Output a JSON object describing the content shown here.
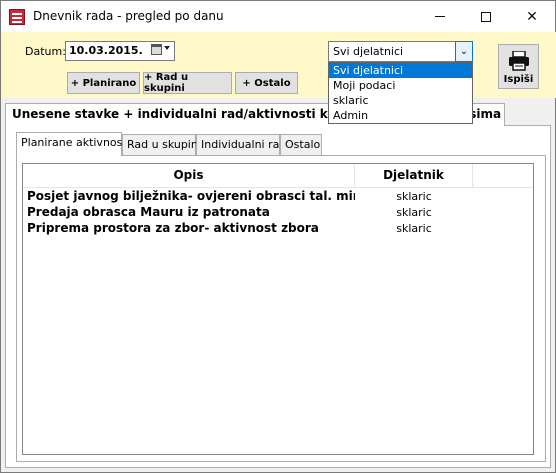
{
  "window": {
    "title": "Dnevnik rada - pregled po danu"
  },
  "filters": {
    "date_label": "Datum:",
    "date_value": "10.03.2015.",
    "worker_selected": "Svi djelatnici",
    "worker_options": [
      "Svi djelatnici",
      "Moji podaci",
      "sklaric",
      "Admin"
    ]
  },
  "toolbar": {
    "planirano": "+ Planirano",
    "rad_u_skupini": "+ Rad u skupini",
    "ostalo": "+ Ostalo",
    "print": "Ispiši"
  },
  "outer_tab": {
    "label_left": "Unesene stavke + individualni rad/aktivnosti korisn",
    "label_right": "osima"
  },
  "inner_tabs": [
    "Planirane aktivnosti",
    "Rad u skupini",
    "Individualni rad",
    "Ostalo"
  ],
  "table": {
    "columns": [
      "Opis",
      "Djelatnik"
    ],
    "rows": [
      {
        "opis": "Posjet javnog bilježnika- ovjereni obrasci tal. mirovi...",
        "djelatnik": "sklaric"
      },
      {
        "opis": "Predaja obrasca Mauru iz patronata",
        "djelatnik": "sklaric"
      },
      {
        "opis": "Priprema prostora za zbor- aktivnost zbora",
        "djelatnik": "sklaric"
      }
    ]
  },
  "colors": {
    "panel_bg": "#fff9c9",
    "selection": "#0078d7"
  }
}
